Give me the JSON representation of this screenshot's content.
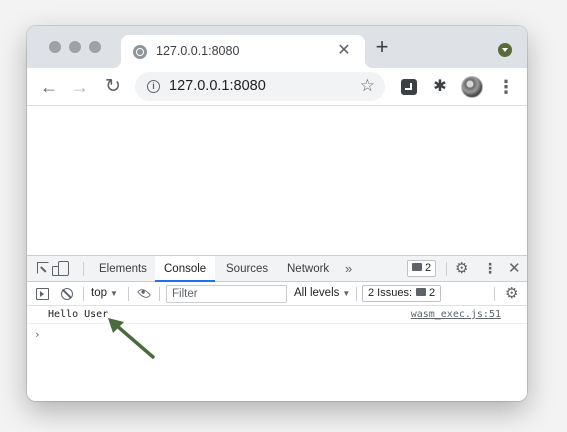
{
  "browser": {
    "tab": {
      "title": "127.0.0.1:8080",
      "close_glyph": "✕"
    },
    "new_tab_glyph": "+",
    "address_bar": {
      "url": "127.0.0.1:8080",
      "info_glyph": "i",
      "star_glyph": "☆"
    },
    "nav": {
      "back_glyph": "←",
      "forward_glyph": "→",
      "reload_glyph": "↻"
    },
    "extensions": {
      "puzzle_glyph": "✱"
    },
    "menu_glyph": "⋮",
    "icons": [
      "site-info-icon",
      "star-icon",
      "extension-icon",
      "puzzle-icon",
      "avatar",
      "menu-icon",
      "profile-icon"
    ]
  },
  "devtools": {
    "tabs": [
      {
        "label": "Elements",
        "active": false
      },
      {
        "label": "Console",
        "active": true
      },
      {
        "label": "Sources",
        "active": false
      },
      {
        "label": "Network",
        "active": false
      }
    ],
    "more_tabs_glyph": "»",
    "messages_count": "2",
    "gear_glyph": "⚙",
    "kebab_glyph": "⋮",
    "close_glyph": "✕",
    "accent_color": "#1a73e8"
  },
  "console": {
    "context": "top",
    "dropdown_glyph": "▼",
    "filter_placeholder": "Filter",
    "log_levels": "All levels",
    "issues_label": "2 Issues:",
    "issues_count": "2",
    "logs": [
      {
        "message": "Hello User",
        "source": "wasm_exec.js:51"
      }
    ],
    "prompt_glyph": "›"
  },
  "annotation": {
    "arrow_color": "#4a6b3c"
  }
}
